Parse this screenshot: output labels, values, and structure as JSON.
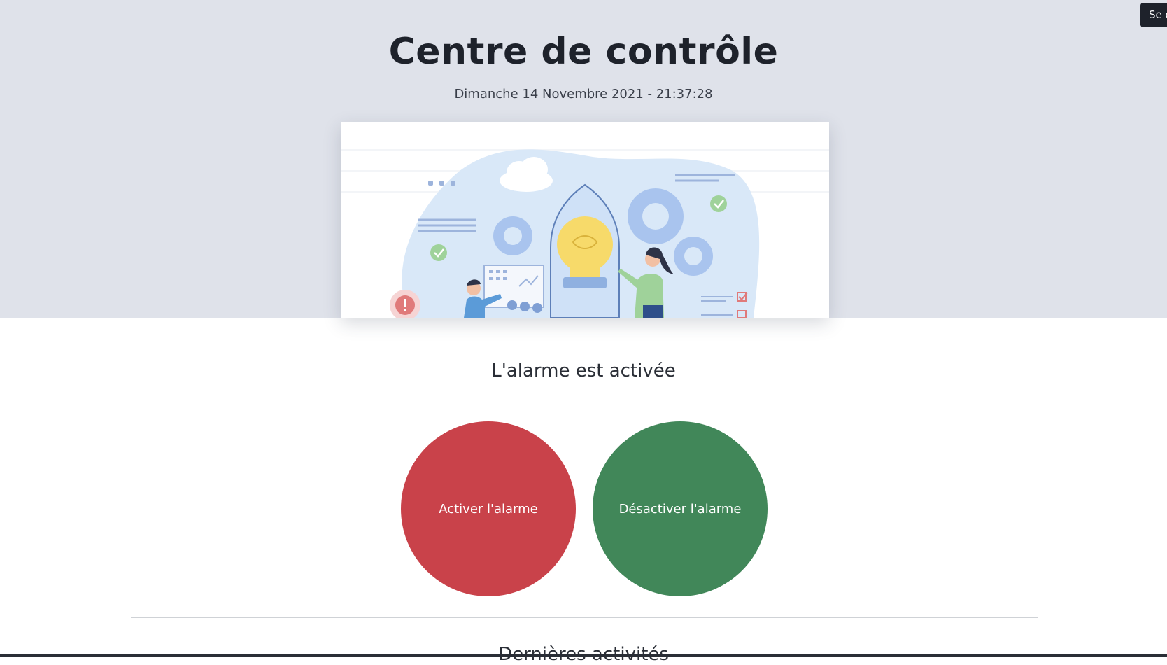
{
  "header": {
    "title": "Centre de contrôle",
    "datetime": "Dimanche 14 Novembre 2021 - 21:37:28",
    "logout_label": "Se d"
  },
  "alarm": {
    "status_text": "L'alarme est activée",
    "activate_label": "Activer l'alarme",
    "deactivate_label": "Désactiver l'alarme"
  },
  "activity": {
    "section_title": "Dernières activités"
  },
  "colors": {
    "hero_background": "#dfe2ea",
    "activate_button": "#c9424a",
    "deactivate_button": "#418759",
    "text_dark": "#1e222b"
  }
}
